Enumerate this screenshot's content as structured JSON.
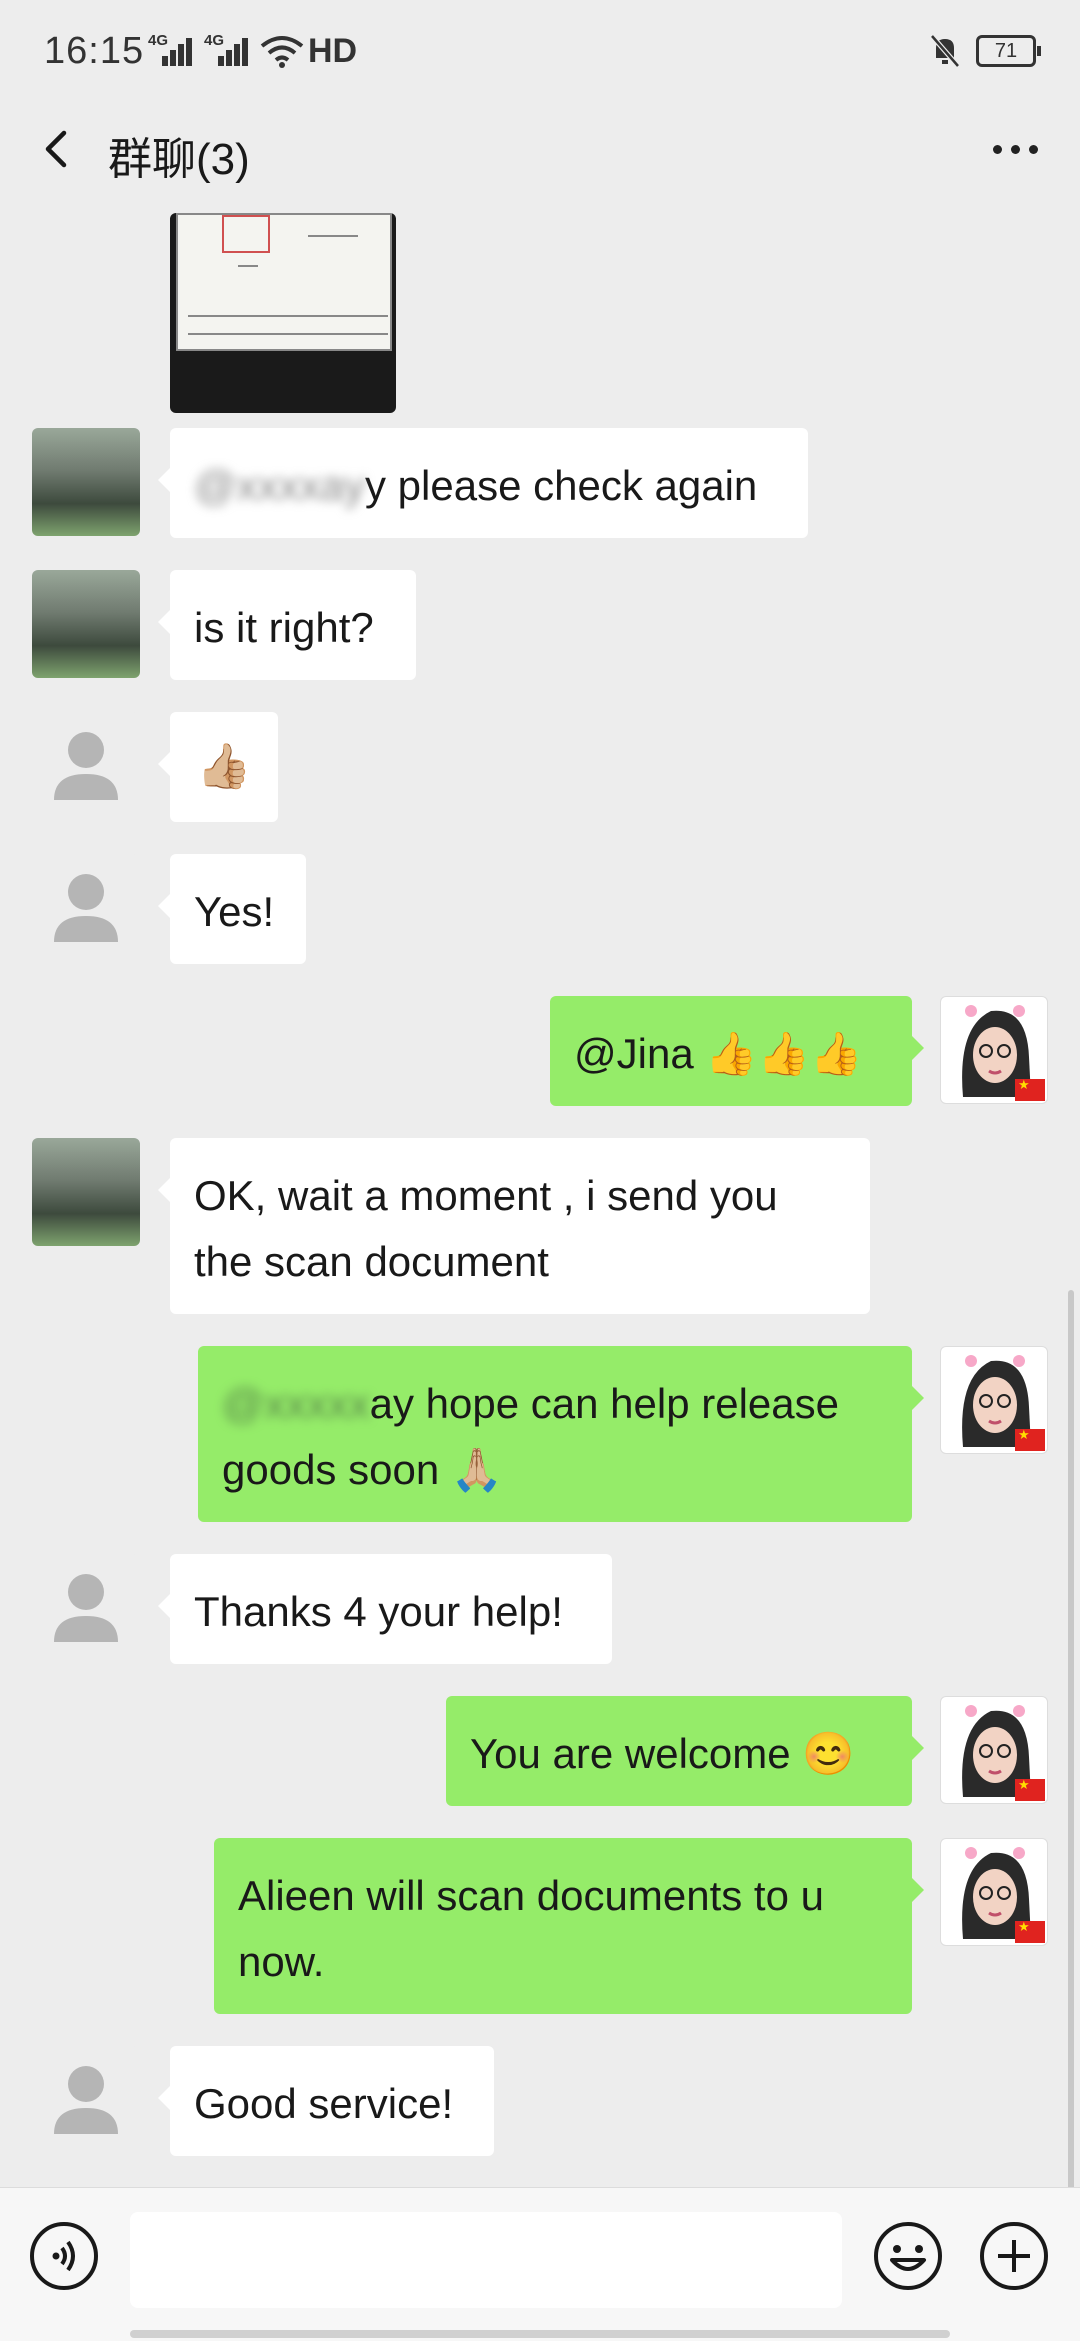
{
  "status": {
    "time": "16:15",
    "network1": "4G",
    "network2": "4G",
    "hd": "HD",
    "battery": "71"
  },
  "nav": {
    "title": "群聊(3)"
  },
  "messages": [
    {
      "side": "left",
      "avatar": "group-member-avatar",
      "blurred_prefix": "@xxxxay",
      "text": "y please check again"
    },
    {
      "side": "left",
      "avatar": "group-member-avatar",
      "text": "is it right?"
    },
    {
      "side": "left",
      "avatar": "default-avatar",
      "emoji": "👍🏼"
    },
    {
      "side": "left",
      "avatar": "default-avatar",
      "text": "Yes!"
    },
    {
      "side": "right",
      "avatar": "self-avatar",
      "text": "@Jina 👍👍👍"
    },
    {
      "side": "left",
      "avatar": "group-member-avatar",
      "line1": "OK,  wait  a moment , i send you",
      "line2": "the scan document"
    },
    {
      "side": "right",
      "avatar": "self-avatar",
      "blurred_prefix": "@xxxxx",
      "line1": "ay hope can help  release",
      "line2": "goods soon 🙏🏼"
    },
    {
      "side": "left",
      "avatar": "default-avatar",
      "text": "Thanks 4 your help!"
    },
    {
      "side": "right",
      "avatar": "self-avatar",
      "text": "You are welcome 😊"
    },
    {
      "side": "right",
      "avatar": "self-avatar",
      "line1": "Alieen will scan documents to u",
      "line2": "now."
    },
    {
      "side": "left",
      "avatar": "default-avatar",
      "text": "Good service!"
    }
  ],
  "input": {
    "value": "",
    "placeholder": ""
  },
  "icons": {
    "back": "back-arrow-icon",
    "more": "more-dots-icon",
    "voice": "voice-icon",
    "emoji": "emoji-icon",
    "plus": "plus-icon"
  },
  "colors": {
    "background": "#ededed",
    "sent_bubble": "#95ec69",
    "received_bubble": "#ffffff"
  }
}
